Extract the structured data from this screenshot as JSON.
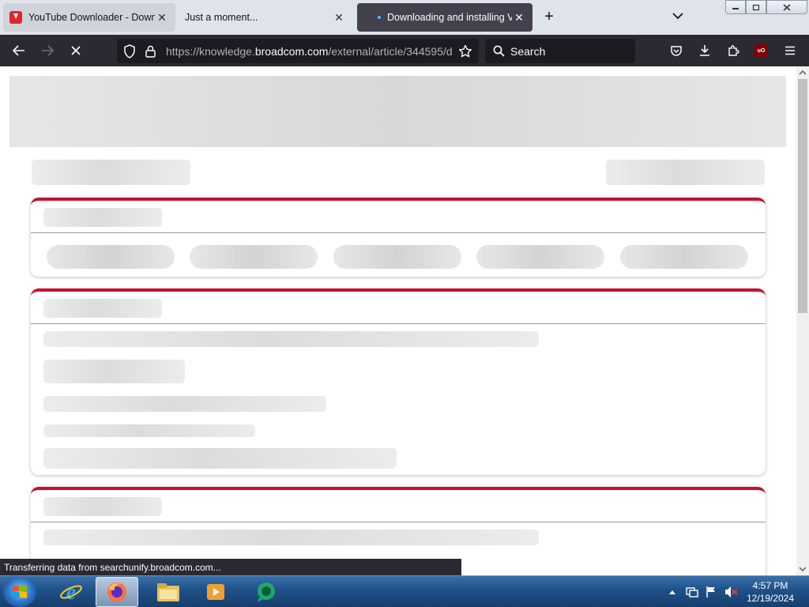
{
  "tabs": [
    {
      "title": "YouTube Downloader - Download",
      "favicon": "youtube-downloader-icon",
      "close": "✕"
    },
    {
      "title": "Just a moment...",
      "close": "✕"
    },
    {
      "title": "Downloading and installing VMware",
      "favicon": "loading-dot-icon",
      "close": "✕",
      "active": true
    }
  ],
  "tabstrip": {
    "new_tab": "+",
    "list_all_tabs": "chevron-down-icon"
  },
  "window_controls": {
    "minimize": "minimize-icon",
    "maximize": "maximize-icon",
    "close": "close-icon"
  },
  "nav": {
    "url_prefix": "https://knowledge.",
    "url_domain": "broadcom.com",
    "url_path": "/external/article/344595/d",
    "search_placeholder": "Search",
    "ublock_label": "uO"
  },
  "status_bar": {
    "text": "Transferring data from searchunify.broadcom.com..."
  },
  "taskbar": {
    "apps": [
      "internet-explorer-icon",
      "firefox-icon",
      "file-explorer-icon",
      "media-player-icon",
      "chat-app-icon"
    ],
    "clock_time": "4:57 PM",
    "clock_date": "12/19/2024"
  },
  "colors": {
    "card_accent": "#c8102e",
    "toolbar_bg": "#2b2a33",
    "active_tab": "#42414d"
  }
}
